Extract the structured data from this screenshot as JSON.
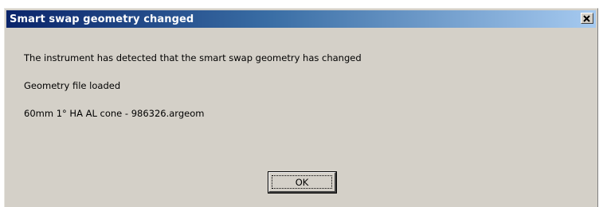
{
  "window": {
    "title": "Smart swap geometry changed",
    "close_icon": "close-icon"
  },
  "message": {
    "line1": "The instrument has detected that the smart swap geometry has changed",
    "line2": "Geometry file loaded",
    "line3": "60mm 1° HA AL cone - 986326.argeom"
  },
  "buttons": {
    "ok_label": "OK"
  },
  "colors": {
    "dialog_background": "#d4d0c8",
    "title_gradient_start": "#0a246a",
    "title_gradient_end": "#a6caf0",
    "title_text": "#ffffff"
  }
}
